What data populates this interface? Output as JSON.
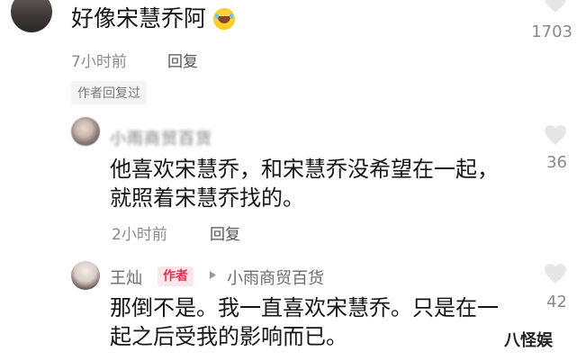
{
  "comments": [
    {
      "text": "好像宋慧乔阿",
      "time": "7小时前",
      "reply": "回复",
      "likes": "1703",
      "author_replied": "作者回复过"
    },
    {
      "user": "小雨商贸百货",
      "text_line1": "他喜欢宋慧乔，和宋慧乔没希望在一起，",
      "text_line2": "就照着宋慧乔找的。",
      "time": "2小时前",
      "reply": "回复",
      "likes": "36"
    },
    {
      "user": "王灿",
      "badge": "作者",
      "reply_to": "小雨商贸百货",
      "text_line1": "那倒不是。我一直喜欢宋慧乔。只是在一",
      "text_line2": "起之后受我的影响而已。",
      "likes": "42"
    }
  ],
  "watermark": "八怪娱",
  "icons": {
    "like": "heart-icon",
    "reply_arrow": "triangle-right-icon",
    "emoji": "laughing-tears-emoji-icon"
  },
  "colors": {
    "author_badge": "#e0344f",
    "heart": "#e6e6e6"
  }
}
